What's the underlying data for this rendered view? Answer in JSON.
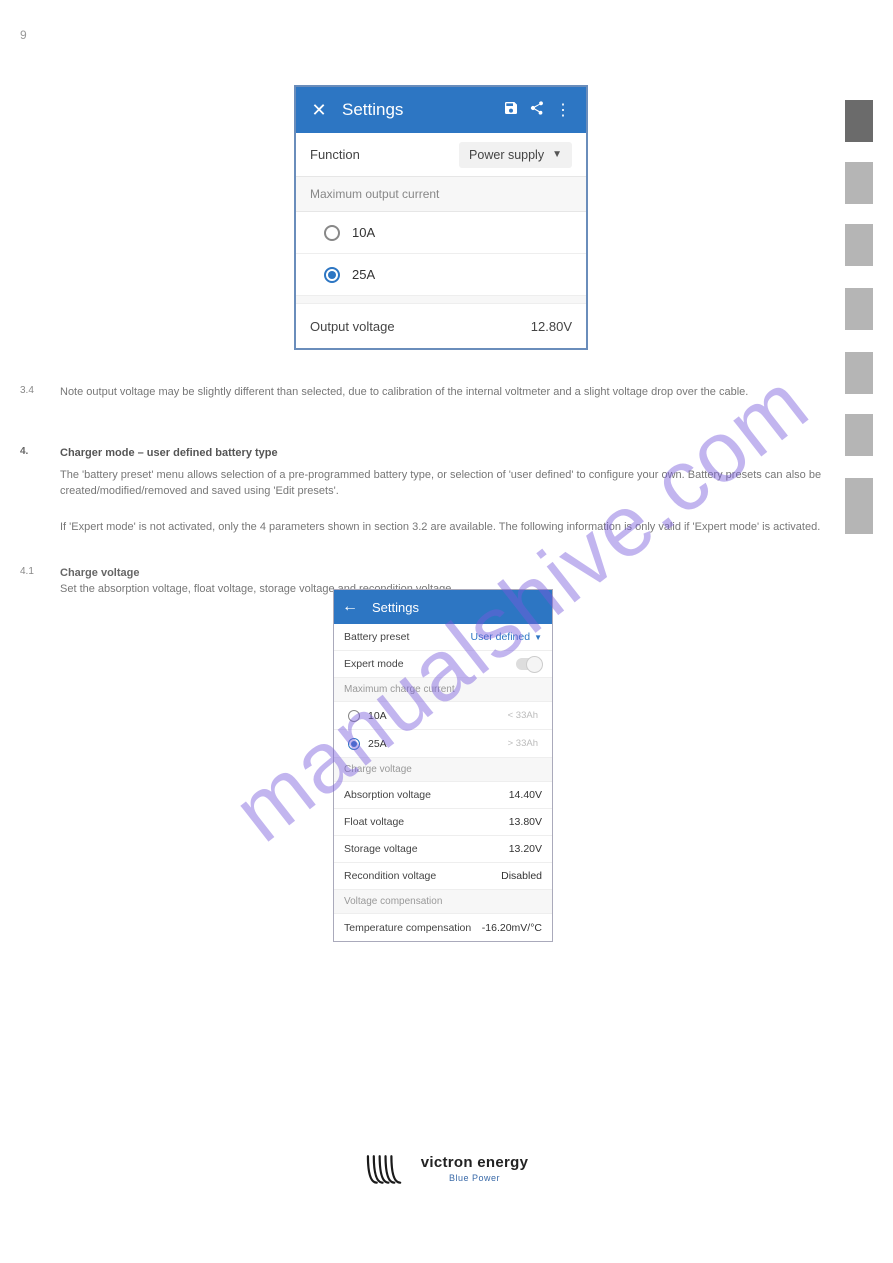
{
  "page_number": "9",
  "watermark_text": "manualshive.com",
  "sidebar_tabs": 7,
  "para_3_4": "Note output voltage may be slightly different than selected, due to calibration of the internal voltmeter and a slight voltage drop over the cable.",
  "sec_3_4": "3.4",
  "sec_4": "4.",
  "heading_4": "Charger mode – user defined battery type",
  "para_4a": "The 'battery preset' menu allows selection of a pre-programmed battery type, or selection of 'user defined' to configure your own. Battery presets can also be created/modified/removed and saved using 'Edit presets'.",
  "para_4b": "If 'Expert mode' is not activated, only the 4 parameters shown in section 3.2 are available. The following information is only valid if 'Expert mode' is activated.",
  "sec_4_1": "4.1",
  "heading_4_1": "Charge voltage",
  "para_4_1": "Set the absorption voltage, float voltage, storage voltage and recondition voltage.",
  "footer_brand": "victron energy",
  "footer_sub": "Blue Power",
  "card1": {
    "title": "Settings",
    "function_label": "Function",
    "function_value": "Power supply",
    "section_max_output": "Maximum output current",
    "opt_10a": "10A",
    "opt_25a": "25A",
    "output_voltage_label": "Output voltage",
    "output_voltage_value": "12.80V"
  },
  "card2": {
    "title": "Settings",
    "battery_preset_label": "Battery preset",
    "battery_preset_value": "User defined",
    "expert_mode_label": "Expert mode",
    "section_max_charge": "Maximum charge current",
    "opt_10a": "10A",
    "opt_25a": "25A",
    "hint_10a": "< 33Ah",
    "hint_25a": "> 33Ah",
    "section_charge_voltage": "Charge voltage",
    "absorption_label": "Absorption voltage",
    "absorption_value": "14.40V",
    "float_label": "Float voltage",
    "float_value": "13.80V",
    "storage_label": "Storage voltage",
    "storage_value": "13.20V",
    "recond_label": "Recondition voltage",
    "recond_value": "Disabled",
    "section_voltage_comp": "Voltage compensation",
    "temp_comp_label": "Temperature compensation",
    "temp_comp_value": "-16.20mV/°C"
  }
}
